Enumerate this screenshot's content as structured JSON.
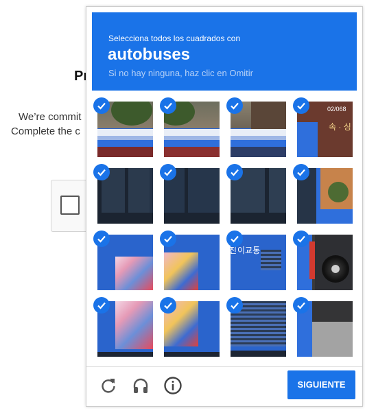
{
  "background_page": {
    "title_fragment": "Pr",
    "line1_fragment": "We’re commit",
    "line2_fragment": "Complete the c"
  },
  "challenge": {
    "instruction": "Selecciona todos los cuadrados con",
    "target": "autobuses",
    "hint": "Si no hay ninguna, haz clic en Omitir",
    "tile_texts": {
      "sign_number": "02/068",
      "sign_korean": "속 · 싱",
      "bus_korean_1": "진",
      "bus_korean_2": "이교통"
    },
    "grid": {
      "rows": 4,
      "cols": 4,
      "selected_count": 16
    },
    "next_label": "SIGUIENTE"
  },
  "icons": {
    "reload": "reload-icon",
    "audio": "headphones-icon",
    "info": "info-icon",
    "check": "check-icon"
  },
  "colors": {
    "accent": "#1a73e8",
    "banner_hint": "#b8d2f7"
  }
}
